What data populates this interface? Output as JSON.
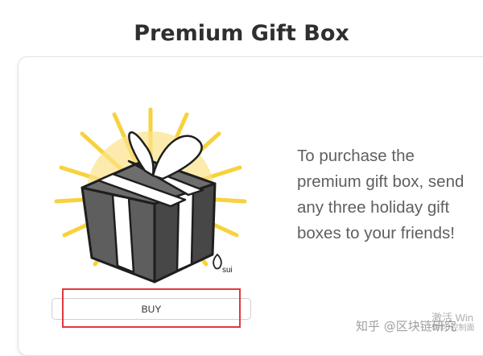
{
  "page": {
    "title": "Premium Gift Box"
  },
  "card": {
    "image_icon": "gift-box-icon",
    "logo_text": "sui",
    "description": "To purchase the premium gift box, send any three holiday gift boxes to your friends!",
    "buy_label": "BUY"
  },
  "overlay": {
    "watermark": "知乎 @区块链研究",
    "activation_line1": "激活 Win",
    "activation_line2": "转到\"控制面"
  },
  "colors": {
    "highlight": "#e0393e",
    "rays": "#f7d23c",
    "box": "#555555",
    "ribbon": "#ffffff"
  }
}
